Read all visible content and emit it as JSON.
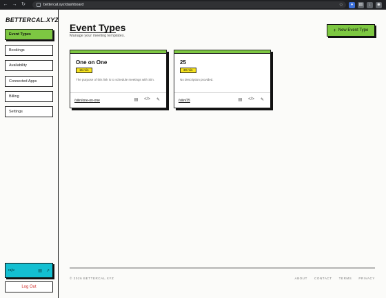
{
  "browser": {
    "url": "bettercal.xyz/dashboard"
  },
  "sidebar": {
    "brand": "BETTERCAL.XYZ",
    "items": [
      {
        "label": "Event Types",
        "active": true
      },
      {
        "label": "Bookings",
        "active": false
      },
      {
        "label": "Availability",
        "active": false
      },
      {
        "label": "Connected Apps",
        "active": false
      },
      {
        "label": "Billing",
        "active": false
      },
      {
        "label": "Settings",
        "active": false
      }
    ],
    "user": {
      "name": "rajiv"
    },
    "logout_label": "Log Out"
  },
  "header": {
    "title": "Event Types",
    "subtitle": "Manage your meeting templates.",
    "new_button": "New Event Type"
  },
  "event_types": [
    {
      "name": "One on One",
      "duration": "15 min",
      "description": "The purpose of this link is to schedule meetings with Siin.",
      "slug": "/siiin/one-on-one"
    },
    {
      "name": "25",
      "duration": "30 min",
      "description": "No description provided.",
      "slug": "/siiin/25"
    }
  ],
  "footer": {
    "copyright": "© 2026 BETTERCAL.XYZ",
    "links": [
      "ABOUT",
      "CONTACT",
      "TERMS",
      "PRIVACY"
    ]
  },
  "colors": {
    "accent_green": "#7dc742",
    "badge_yellow": "#f7e31e",
    "user_cyan": "#13bfd1",
    "logout_red": "#d0302c"
  }
}
